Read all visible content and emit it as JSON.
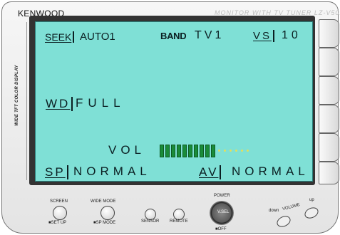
{
  "header": {
    "brand": "KENWOOD",
    "model": "MONITOR WITH TV TUNER LZ-V501"
  },
  "side_label": "WIDE TFT COLOR DISPLAY",
  "screen": {
    "seek": {
      "label": "SEEK",
      "value": "AUTO1"
    },
    "band": {
      "label": "BAND",
      "value": "TV1"
    },
    "vs": {
      "label": "VS",
      "value": "10"
    },
    "wd": {
      "label": "WD",
      "value": "FULL"
    },
    "vol": {
      "label": "VOL",
      "level": 10,
      "max": 16,
      "bar_color": "#1a8c3a",
      "empty_color": "#e4e05a"
    },
    "sp": {
      "label": "SP",
      "value": "NORMAL"
    },
    "av": {
      "label": "AV",
      "value": "NORMAL"
    }
  },
  "controls": {
    "screen": {
      "label": "SCREEN",
      "sub": "■SET UP"
    },
    "wide_mode": {
      "label": "WIDE MODE",
      "sub": "■SP MODE"
    },
    "sensor": "SENSOR",
    "remote": "REMOTE",
    "power": {
      "label": "POWER",
      "button": "V.SEL",
      "sub": "■OFF"
    },
    "volume": {
      "label": "VOLUME",
      "down": "down",
      "up": "up"
    }
  },
  "colors": {
    "screen_bg": "#7fe0d6",
    "text": "#0b1f22"
  }
}
